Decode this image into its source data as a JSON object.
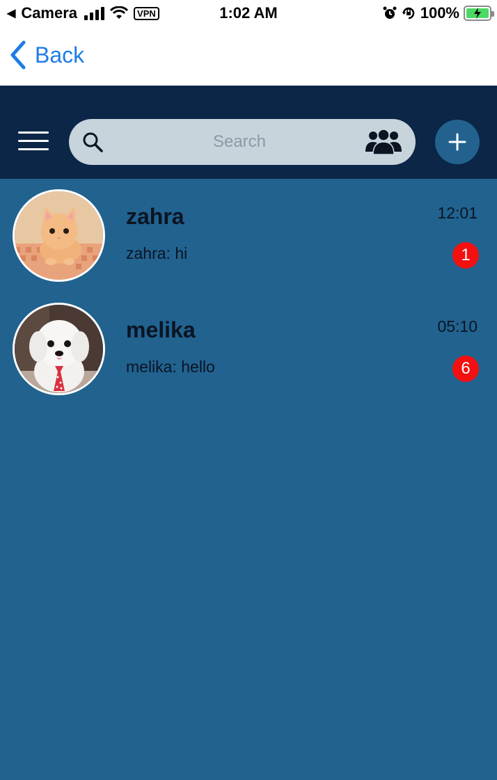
{
  "status_bar": {
    "back_app": "Camera",
    "vpn": "VPN",
    "time": "1:02 AM",
    "battery": "100%"
  },
  "nav": {
    "back_label": "Back"
  },
  "header": {
    "search_placeholder": "Search"
  },
  "chats": [
    {
      "name": "zahra",
      "preview": "zahra: hi",
      "time": "12:01",
      "unread": "1"
    },
    {
      "name": "melika",
      "preview": "melika: hello",
      "time": "05:10",
      "unread": "6"
    }
  ],
  "colors": {
    "background": "#21628f",
    "header": "#0b2646",
    "search": "#c7d4dc",
    "badge": "#f21010",
    "link": "#1e7ce6"
  }
}
